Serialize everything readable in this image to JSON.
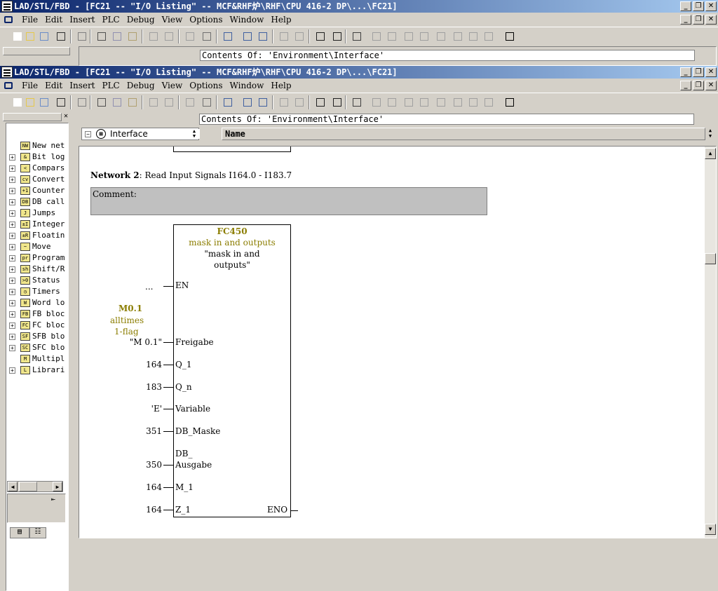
{
  "app_title": "LAD/STL/FBD  - [FC21 -- \"I/O Listing\" -- MCF&RHF炉\\RHF\\CPU 416-2 DP\\...\\FC21]",
  "menu": [
    "File",
    "Edit",
    "Insert",
    "PLC",
    "Debug",
    "View",
    "Options",
    "Window",
    "Help"
  ],
  "window_controls": {
    "minimize": "_",
    "restore": "❐",
    "close": "✕"
  },
  "contents_label": "Contents Of: 'Environment\\Interface'",
  "interface_combo": "Interface",
  "name_header": "Name",
  "tree": [
    {
      "label": "New net",
      "icon": "NW"
    },
    {
      "label": "Bit log",
      "icon": "&"
    },
    {
      "label": "Compars",
      "icon": "<"
    },
    {
      "label": "Convert",
      "icon": "cv"
    },
    {
      "label": "Counter",
      "icon": "+1"
    },
    {
      "label": "DB call",
      "icon": "DB"
    },
    {
      "label": "Jumps",
      "icon": "J"
    },
    {
      "label": "Integer",
      "icon": "±I"
    },
    {
      "label": "Floatin",
      "icon": "±R"
    },
    {
      "label": "Move",
      "icon": "~"
    },
    {
      "label": "Program",
      "icon": "pr"
    },
    {
      "label": "Shift/R",
      "icon": "sh"
    },
    {
      "label": "Status",
      "icon": ">0"
    },
    {
      "label": "Timers",
      "icon": "◷"
    },
    {
      "label": "Word lo",
      "icon": "W"
    },
    {
      "label": "FB bloc",
      "icon": "FB"
    },
    {
      "label": "FC bloc",
      "icon": "FC"
    },
    {
      "label": "SFB blo",
      "icon": "SF"
    },
    {
      "label": "SFC blo",
      "icon": "SC"
    },
    {
      "label": "Multipl",
      "icon": "M"
    },
    {
      "label": "Librari",
      "icon": "L"
    }
  ],
  "network": {
    "title_bold": "Network 2",
    "title_rest": ": Read Input Signals I164.0 - I183.7",
    "comment_label": "Comment:"
  },
  "block": {
    "name": "FC450",
    "symbol": "mask in and outputs",
    "quoted_line1": "\"mask in and",
    "quoted_line2": "outputs\"",
    "en_value": "...",
    "en_label": "EN",
    "m01_addr": "M0.1",
    "m01_sym1": "alltimes",
    "m01_sym2": "1-flag",
    "pins": [
      {
        "value": "\"M 0.1\"",
        "label": "Freigabe"
      },
      {
        "value": "164",
        "label": "Q_1"
      },
      {
        "value": "183",
        "label": "Q_n"
      },
      {
        "value": "'E'",
        "label": "Variable"
      },
      {
        "value": "351",
        "label": "DB_Maske"
      },
      {
        "value": "350",
        "label": "DB_\nAusgabe",
        "label1": "DB_",
        "label2": "Ausgabe"
      },
      {
        "value": "164",
        "label": "M_1"
      },
      {
        "value": "164",
        "label": "Z_1"
      }
    ],
    "eno_label": "ENO"
  }
}
